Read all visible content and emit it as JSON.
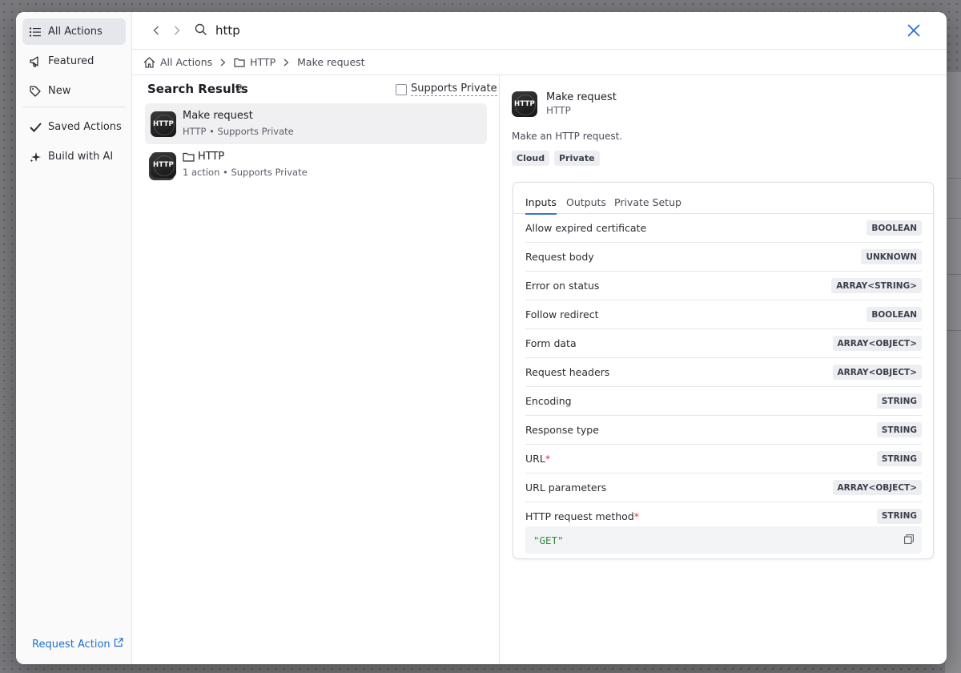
{
  "sidebar": {
    "items": [
      {
        "label": "All Actions",
        "icon": "list-icon"
      },
      {
        "label": "Featured",
        "icon": "megaphone-icon"
      },
      {
        "label": "New",
        "icon": "tag-icon"
      },
      {
        "label": "Saved Actions",
        "icon": "check-icon"
      },
      {
        "label": "Build with AI",
        "icon": "sparkle-icon"
      }
    ],
    "request_action": "Request Action"
  },
  "search": {
    "value": "http"
  },
  "breadcrumb": {
    "items": [
      "All Actions",
      "HTTP",
      "Make request"
    ]
  },
  "results": {
    "title": "Search Results",
    "count": "2",
    "filter_label": "Supports Private",
    "items": [
      {
        "logo": "HTTP",
        "title": "Make request",
        "subtitle": "HTTP • Supports Private"
      },
      {
        "logo": "HTTP",
        "title": "HTTP",
        "subtitle": "1 action • Supports Private"
      }
    ]
  },
  "details": {
    "logo": "HTTP",
    "title": "Make request",
    "subtitle": "HTTP",
    "description": "Make an HTTP request.",
    "tags": [
      "Cloud",
      "Private"
    ],
    "tabs": [
      "Inputs",
      "Outputs",
      "Private Setup"
    ],
    "inputs": [
      {
        "label": "Allow expired certificate",
        "type": "BOOLEAN",
        "required": ""
      },
      {
        "label": "Request body",
        "type": "UNKNOWN",
        "required": ""
      },
      {
        "label": "Error on status",
        "type": "ARRAY<STRING>",
        "required": ""
      },
      {
        "label": "Follow redirect",
        "type": "BOOLEAN",
        "required": ""
      },
      {
        "label": "Form data",
        "type": "ARRAY<OBJECT>",
        "required": ""
      },
      {
        "label": "Request headers",
        "type": "ARRAY<OBJECT>",
        "required": ""
      },
      {
        "label": "Encoding",
        "type": "STRING",
        "required": ""
      },
      {
        "label": "Response type",
        "type": "STRING",
        "required": ""
      },
      {
        "label": "URL",
        "type": "STRING",
        "required": "*"
      },
      {
        "label": "URL parameters",
        "type": "ARRAY<OBJECT>",
        "required": ""
      },
      {
        "label": "HTTP request method",
        "type": "STRING",
        "required": "*"
      }
    ],
    "default_value": "\"GET\""
  },
  "colors": {
    "accent": "#3c6fd6",
    "link": "#1f6fd1",
    "required": "#d8343a",
    "code_green": "#2e8a3e"
  }
}
